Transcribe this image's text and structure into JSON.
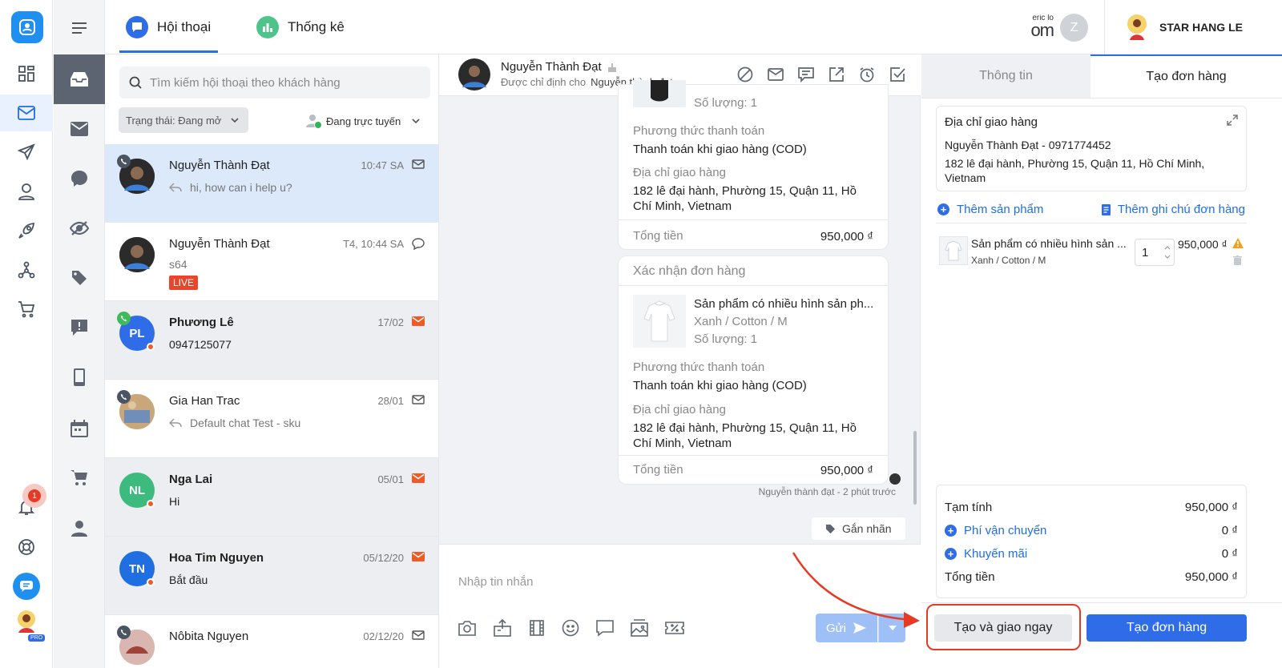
{
  "top_tabs": {
    "conversations": "Hội thoại",
    "stats": "Thống kê"
  },
  "header_right": {
    "brand_fragment": "eric lo",
    "brand_fragment2": "om",
    "avatar_letter": "Z",
    "user_name": "STAR HANG LE"
  },
  "rail": {
    "notification_count": "1",
    "pro_badge": "PRO"
  },
  "list": {
    "search_placeholder": "Tìm kiếm hội thoại theo khách hàng",
    "filter_label": "Trạng thái: Đang mở",
    "online_label": "Đang trực tuyến",
    "items": [
      {
        "name": "Nguyễn Thành Đạt",
        "time": "10:47 SA",
        "preview": "hi, how can i help u?",
        "icon": "mail-icon"
      },
      {
        "name": "Nguyễn Thành Đạt",
        "time": "T4, 10:44 SA",
        "preview": "s64",
        "tag": "LIVE",
        "icon": "comment-icon"
      },
      {
        "name": "Phương Lê",
        "initials": "PL",
        "time": "17/02",
        "preview": "0947125077",
        "icon": "mail-icon"
      },
      {
        "name": "Gia Han Trac",
        "time": "28/01",
        "preview": "Default chat Test - sku",
        "icon": "mail-icon"
      },
      {
        "name": "Nga Lai",
        "initials": "NL",
        "time": "05/01",
        "preview": "Hi",
        "icon": "mail-icon"
      },
      {
        "name": "Hoa Tim Nguyen",
        "initials": "TN",
        "time": "05/12/20",
        "preview": "Bắt đầu",
        "icon": "mail-icon"
      },
      {
        "name": "Nôbita Nguyen",
        "time": "02/12/20",
        "preview": "",
        "icon": "mail-icon"
      }
    ],
    "colors": {
      "selected_bg": "#dbe9fb",
      "unread_bg": "#eceef1",
      "pl": "#2f6de8",
      "nl": "#3dbb7e",
      "tn": "#1f6fe0"
    }
  },
  "chat": {
    "contact_name": "Nguyễn Thành Đạt",
    "assigned_prefix": "Được chỉ định cho",
    "assigned_to": "Nguyễn thành đạt",
    "card1": {
      "qty": "Số lượng: 1",
      "payment_label": "Phương thức thanh toán",
      "payment_value": "Thanh toán khi giao hàng (COD)",
      "address_label": "Địa chỉ giao hàng",
      "address_value": "182 lê đại hành, Phường 15, Quận 11, Hồ Chí Minh, Vietnam",
      "total_label": "Tổng tiền",
      "total_value": "950,000 ₫"
    },
    "card2": {
      "header": "Xác nhận đơn hàng",
      "product_name": "Sản phẩm có nhiều hình sản ph...",
      "variant": "Xanh / Cotton / M",
      "qty": "Số lượng: 1",
      "payment_label": "Phương thức thanh toán",
      "payment_value": "Thanh toán khi giao hàng (COD)",
      "address_label": "Địa chỉ giao hàng",
      "address_value": "182 lê đại hành, Phường 15, Quận 11, Hồ Chí Minh, Vietnam",
      "total_label": "Tổng tiền",
      "total_value": "950,000 ₫"
    },
    "sent_meta": "Nguyễn thành đạt - 2 phút trước",
    "tag_button": "Gắn nhãn",
    "composer_placeholder": "Nhập tin nhắn",
    "send_label": "Gửi"
  },
  "panel": {
    "tab_info": "Thông tin",
    "tab_order": "Tạo đơn hàng",
    "shipping_title": "Địa chỉ giao hàng",
    "shipping_contact": "Nguyễn Thành Đạt - 0971774452",
    "shipping_address": "182 lê đại hành, Phường 15, Quận 11, Hồ Chí Minh, Vietnam",
    "add_product": "Thêm sản phẩm",
    "add_note": "Thêm ghi chú đơn hàng",
    "product": {
      "name": "Sản phẩm có nhiều hình sản ...",
      "variant": "Xanh / Cotton / M",
      "qty": "1",
      "price": "950,000 ₫"
    },
    "subtotal_label": "Tạm tính",
    "subtotal_value": "950,000 ₫",
    "shipping_fee_label": "Phí vận chuyển",
    "shipping_fee_value": "0 ₫",
    "discount_label": "Khuyến mãi",
    "discount_value": "0 ₫",
    "total_label": "Tổng tiền",
    "total_value": "950,000 ₫",
    "create_ship_button": "Tạo và giao ngay",
    "create_order_button": "Tạo đơn hàng"
  },
  "accent": "#2f6de8",
  "annotation_color": "#e53a24"
}
